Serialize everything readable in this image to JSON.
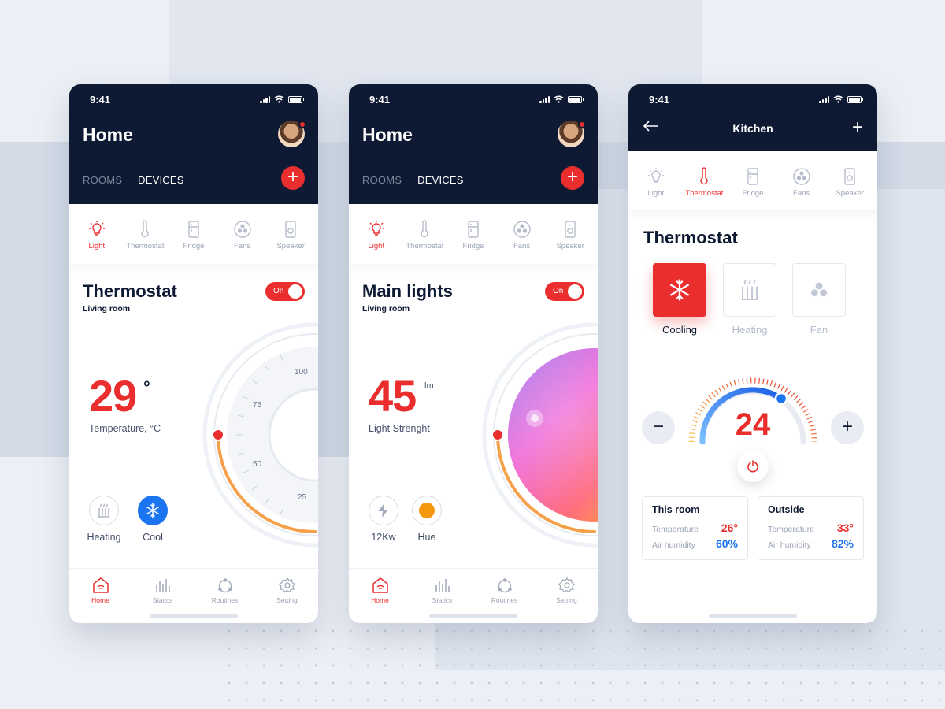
{
  "colors": {
    "accent": "#ea2e2e",
    "navy": "#0e1a33",
    "blue": "#1b74f0",
    "muted": "#9aa3b5"
  },
  "status_time": "9:41",
  "devices": [
    "Light",
    "Thermostat",
    "Fridge",
    "Fans",
    "Speaker"
  ],
  "tabs": [
    "Home",
    "Statics",
    "Routines",
    "Setting"
  ],
  "screen1": {
    "title": "Home",
    "tab_rooms": "ROOMS",
    "tab_devices": "DEVICES",
    "add_label": "+",
    "active_device": "Light",
    "card_title": "Thermostat",
    "card_sub": "Living room",
    "toggle": "On",
    "value": "29",
    "unit": "°",
    "caption": "Temperature, °C",
    "dial_ticks": [
      "100",
      "75",
      "50",
      "25"
    ],
    "modes": [
      {
        "label": "Heating",
        "icon": "heater-icon",
        "active": false
      },
      {
        "label": "Cool",
        "icon": "snowflake-icon",
        "active": true
      }
    ],
    "active_tab": "Home"
  },
  "screen2": {
    "title": "Home",
    "tab_rooms": "ROOMS",
    "tab_devices": "DEVICES",
    "add_label": "+",
    "active_device": "Light",
    "card_title": "Main lights",
    "card_sub": "Living room",
    "toggle": "On",
    "value": "45",
    "unit": "lm",
    "caption": "Light Strenght",
    "modes": [
      {
        "label": "12Kw",
        "icon": "bolt-icon",
        "active": false
      },
      {
        "label": "Hue",
        "icon": "hue-dot-icon",
        "active": false
      }
    ],
    "active_tab": "Home"
  },
  "screen3": {
    "title": "Kitchen",
    "back_icon": "arrow-left-icon",
    "add_label": "+",
    "active_device": "Thermostat",
    "section_title": "Thermostat",
    "modes": [
      {
        "label": "Cooling",
        "icon": "snowflake-icon",
        "active": true
      },
      {
        "label": "Heating",
        "icon": "heater-icon",
        "active": false
      },
      {
        "label": "Fan",
        "icon": "fan-icon",
        "active": false
      }
    ],
    "minus_label": "−",
    "plus_label": "+",
    "temperature": "24",
    "this_room": {
      "title": "This room",
      "temp_label": "Temperature",
      "temp_value": "26°",
      "hum_label": "Air humidity",
      "hum_value": "60%"
    },
    "outside": {
      "title": "Outside",
      "temp_label": "Temperature",
      "temp_value": "33°",
      "hum_label": "Air humidity",
      "hum_value": "82%"
    }
  }
}
